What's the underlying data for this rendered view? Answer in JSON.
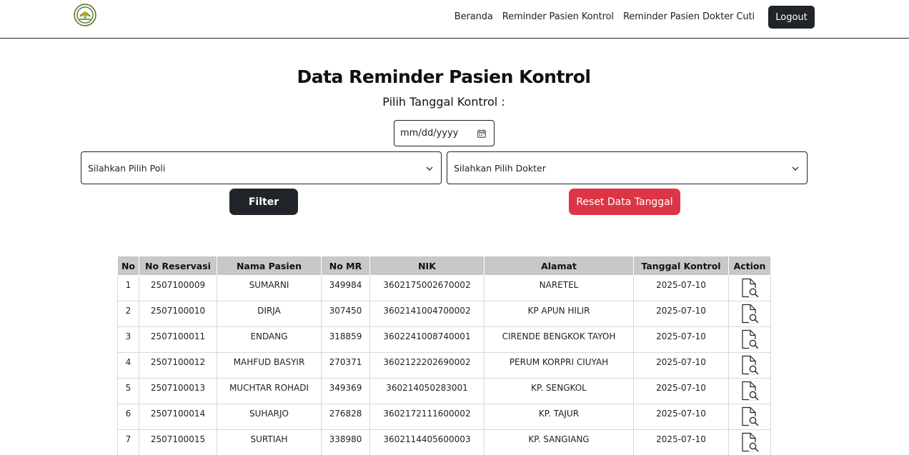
{
  "navbar": {
    "links": [
      {
        "label": "Beranda"
      },
      {
        "label": "Reminder Pasien Kontrol"
      },
      {
        "label": "Reminder Pasien Dokter Cuti"
      }
    ],
    "logout_label": "Logout"
  },
  "header": {
    "title": "Data Reminder Pasien Kontrol",
    "date_label": "Pilih Tanggal Kontrol :",
    "date_placeholder": "mm/dd/yyyy"
  },
  "filters": {
    "poli_placeholder": "Silahkan Pilih Poli",
    "dokter_placeholder": "Silahkan Pilih Dokter",
    "filter_label": "Filter",
    "reset_label": "Reset Data Tanggal"
  },
  "table": {
    "headers": [
      "No",
      "No Reservasi",
      "Nama Pasien",
      "No MR",
      "NIK",
      "Alamat",
      "Tanggal Kontrol",
      "Action"
    ],
    "rows": [
      {
        "no": "1",
        "reservasi": "2507100009",
        "nama": "SUMARNI",
        "mr": "349984",
        "nik": "3602175002670002",
        "alamat": "NARETEL",
        "tanggal": "2025-07-10"
      },
      {
        "no": "2",
        "reservasi": "2507100010",
        "nama": "DIRJA",
        "mr": "307450",
        "nik": "3602141004700002",
        "alamat": "KP APUN HILIR",
        "tanggal": "2025-07-10"
      },
      {
        "no": "3",
        "reservasi": "2507100011",
        "nama": "ENDANG",
        "mr": "318859",
        "nik": "3602241008740001",
        "alamat": "CIRENDE BENGKOK TAYOH",
        "tanggal": "2025-07-10"
      },
      {
        "no": "4",
        "reservasi": "2507100012",
        "nama": "MAHFUD BASYIR",
        "mr": "270371",
        "nik": "3602122202690002",
        "alamat": "PERUM KORPRI CIUYAH",
        "tanggal": "2025-07-10"
      },
      {
        "no": "5",
        "reservasi": "2507100013",
        "nama": "MUCHTAR ROHADI",
        "mr": "349369",
        "nik": "360214050283001",
        "alamat": "KP. SENGKOL",
        "tanggal": "2025-07-10"
      },
      {
        "no": "6",
        "reservasi": "2507100014",
        "nama": "SUHARJO",
        "mr": "276828",
        "nik": "3602172111600002",
        "alamat": "KP. TAJUR",
        "tanggal": "2025-07-10"
      },
      {
        "no": "7",
        "reservasi": "2507100015",
        "nama": "SURTIAH",
        "mr": "338980",
        "nik": "3602114405600003",
        "alamat": "KP. SANGIANG",
        "tanggal": "2025-07-10"
      }
    ]
  },
  "icons": {
    "logo": "hospital-logo",
    "calendar": "calendar-icon",
    "dropdown": "chevron-down-icon",
    "action": "document-search-icon"
  },
  "colors": {
    "dark_button": "#212529",
    "reset_button": "#dc3545",
    "table_header": "#c8c8c8"
  }
}
